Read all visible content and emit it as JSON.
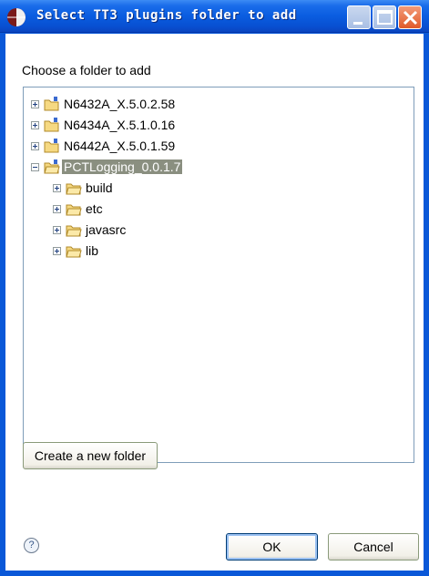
{
  "window": {
    "title": "Select TT3 plugins folder to add",
    "icon": "eclipse-icon",
    "titlebar_color": "#0a5de0"
  },
  "dialog": {
    "prompt": "Choose a folder to add"
  },
  "tree": {
    "nodes": [
      {
        "label": "N6432A_X.5.0.2.58",
        "type": "project",
        "expanded": false,
        "selected": false,
        "level": 0
      },
      {
        "label": "N6434A_X.5.1.0.16",
        "type": "project",
        "expanded": false,
        "selected": false,
        "level": 0
      },
      {
        "label": "N6442A_X.5.0.1.59",
        "type": "project",
        "expanded": false,
        "selected": false,
        "level": 0
      },
      {
        "label": "PCTLogging_0.0.1.7",
        "type": "project",
        "expanded": true,
        "selected": true,
        "level": 0
      },
      {
        "label": "build",
        "type": "folder",
        "expanded": false,
        "selected": false,
        "level": 1
      },
      {
        "label": "etc",
        "type": "folder",
        "expanded": false,
        "selected": false,
        "level": 1
      },
      {
        "label": "javasrc",
        "type": "folder",
        "expanded": false,
        "selected": false,
        "level": 1
      },
      {
        "label": "lib",
        "type": "folder",
        "expanded": false,
        "selected": false,
        "level": 1
      }
    ]
  },
  "buttons": {
    "create_folder": "Create a new folder",
    "ok": "OK",
    "cancel": "Cancel",
    "help_symbol": "?"
  },
  "colors": {
    "selection": "#8a8f80",
    "tree_border": "#7f9db9"
  }
}
